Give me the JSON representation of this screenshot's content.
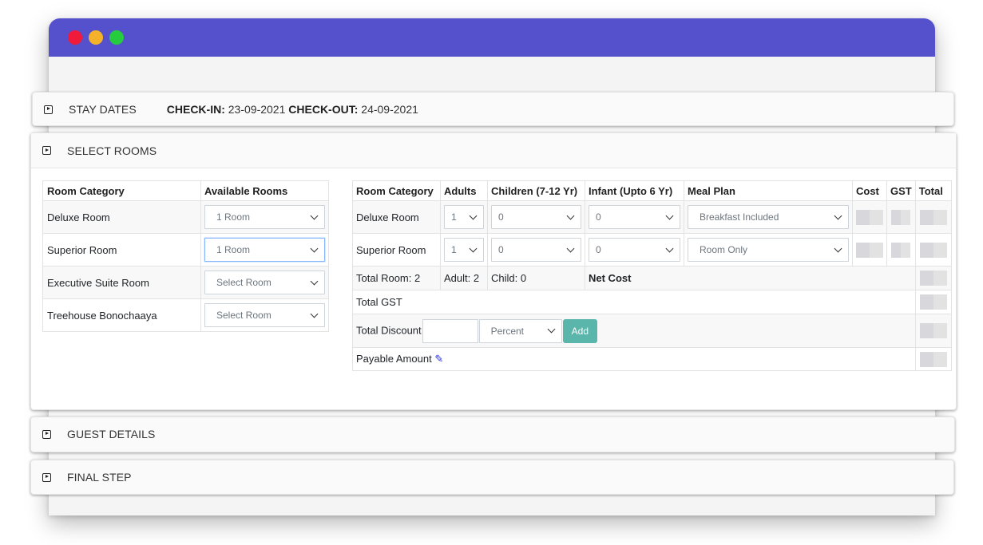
{
  "window": {
    "controls": [
      "close",
      "minimize",
      "maximize"
    ],
    "colors": {
      "titlebar": "#5551cd",
      "close": "#f21a3a",
      "minimize": "#f3b22a",
      "maximize": "#25cc3e"
    }
  },
  "stay_dates": {
    "title": "STAY DATES",
    "checkin_label": "CHECK-IN:",
    "checkin_value": " 23-09-2021 ",
    "checkout_label": "CHECK-OUT:",
    "checkout_value": " 24-09-2021"
  },
  "select_rooms": {
    "title": "SELECT ROOMS",
    "availability": {
      "headers": [
        "Room Category",
        "Available Rooms"
      ],
      "rows": [
        {
          "category": "Deluxe Room",
          "selection": "1 Room"
        },
        {
          "category": "Superior Room",
          "selection": "1 Room"
        },
        {
          "category": "Executive Suite Room",
          "selection": "Select Room"
        },
        {
          "category": "Treehouse Bonochaaya",
          "selection": "Select Room"
        }
      ]
    },
    "booking": {
      "headers": [
        "Room Category",
        "Adults",
        "Children (7-12 Yr)",
        "Infant (Upto 6 Yr)",
        "Meal Plan",
        "Cost",
        "GST",
        "Total"
      ],
      "rows": [
        {
          "category": "Deluxe Room",
          "adults": "1",
          "children": "0",
          "infants": "0",
          "meal_plan": "Breakfast Included"
        },
        {
          "category": "Superior Room",
          "adults": "1",
          "children": "0",
          "infants": "0",
          "meal_plan": "Room Only"
        }
      ],
      "summary": {
        "total_rooms": "Total Room: 2",
        "adults": "Adult: 2",
        "children": "Child: 0",
        "net_cost_label": "Net Cost",
        "total_gst_label": "Total GST",
        "discount_label": "Total Discount",
        "discount_value": "",
        "discount_type": "Percent",
        "add_button": "Add",
        "payable_label": "Payable Amount"
      }
    },
    "colors": {
      "add_button": "#5ab5aa",
      "edit_icon": "#1e2be0"
    }
  },
  "guest_details": {
    "title": "GUEST DETAILS"
  },
  "final_step": {
    "title": "FINAL STEP"
  }
}
